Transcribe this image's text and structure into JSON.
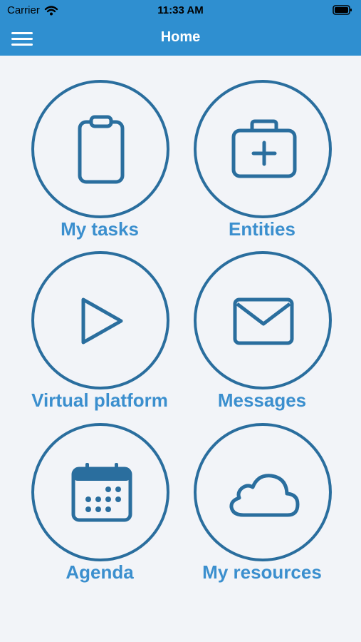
{
  "status_bar": {
    "carrier": "Carrier",
    "time": "11:33 AM",
    "icons": [
      "wifi-icon",
      "battery-icon"
    ]
  },
  "nav": {
    "title": "Home",
    "menu_icon": "hamburger-menu-icon"
  },
  "colors": {
    "nav_bg": "#2f8fd0",
    "circle_stroke": "#2a6e9e",
    "label": "#3b8fce",
    "background": "#f2f4f8"
  },
  "tiles": [
    {
      "label": "My tasks",
      "icon": "clipboard-icon"
    },
    {
      "label": "Entities",
      "icon": "first-aid-case-icon"
    },
    {
      "label": "Virtual platform",
      "icon": "play-icon"
    },
    {
      "label": "Messages",
      "icon": "envelope-icon"
    },
    {
      "label": "Agenda",
      "icon": "calendar-icon"
    },
    {
      "label": "My resources",
      "icon": "cloud-icon"
    }
  ]
}
